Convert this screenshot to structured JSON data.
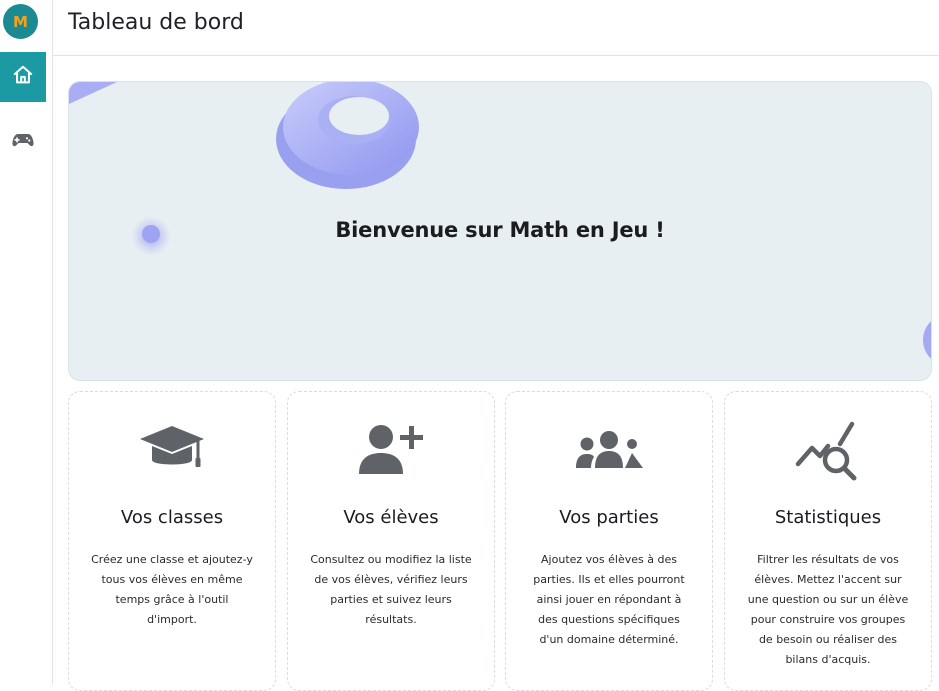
{
  "app": {
    "logo_letter": "M"
  },
  "sidebar": {
    "items": [
      {
        "icon": "home-icon",
        "active": true
      },
      {
        "icon": "gamepad-icon",
        "active": false
      }
    ],
    "accent": "#1c9aa3"
  },
  "header": {
    "title": "Tableau de bord"
  },
  "hero": {
    "title": "Bienvenue sur Math en Jeu !"
  },
  "cards": [
    {
      "icon": "graduation-cap-icon",
      "title": "Vos classes",
      "text": "Créez une classe et ajoutez-y tous vos élèves en même temps grâce à l'outil d'import."
    },
    {
      "icon": "user-plus-icon",
      "title": "Vos élèves",
      "text": "Consultez ou modifiez la liste de vos élèves, vérifiez leurs parties et suivez leurs résultats."
    },
    {
      "icon": "users-group-icon",
      "title": "Vos parties",
      "text": "Ajoutez vos élèves à des parties. Ils et elles pourront ainsi jouer en répondant à des questions spécifiques d'un domaine déterminé."
    },
    {
      "icon": "chart-search-icon",
      "title": "Statistiques",
      "text": "Filtrer les résultats de vos élèves. Mettez l'accent sur une question ou sur un élève pour construire vos groupes de besoin ou réaliser des bilans d'acquis."
    }
  ]
}
